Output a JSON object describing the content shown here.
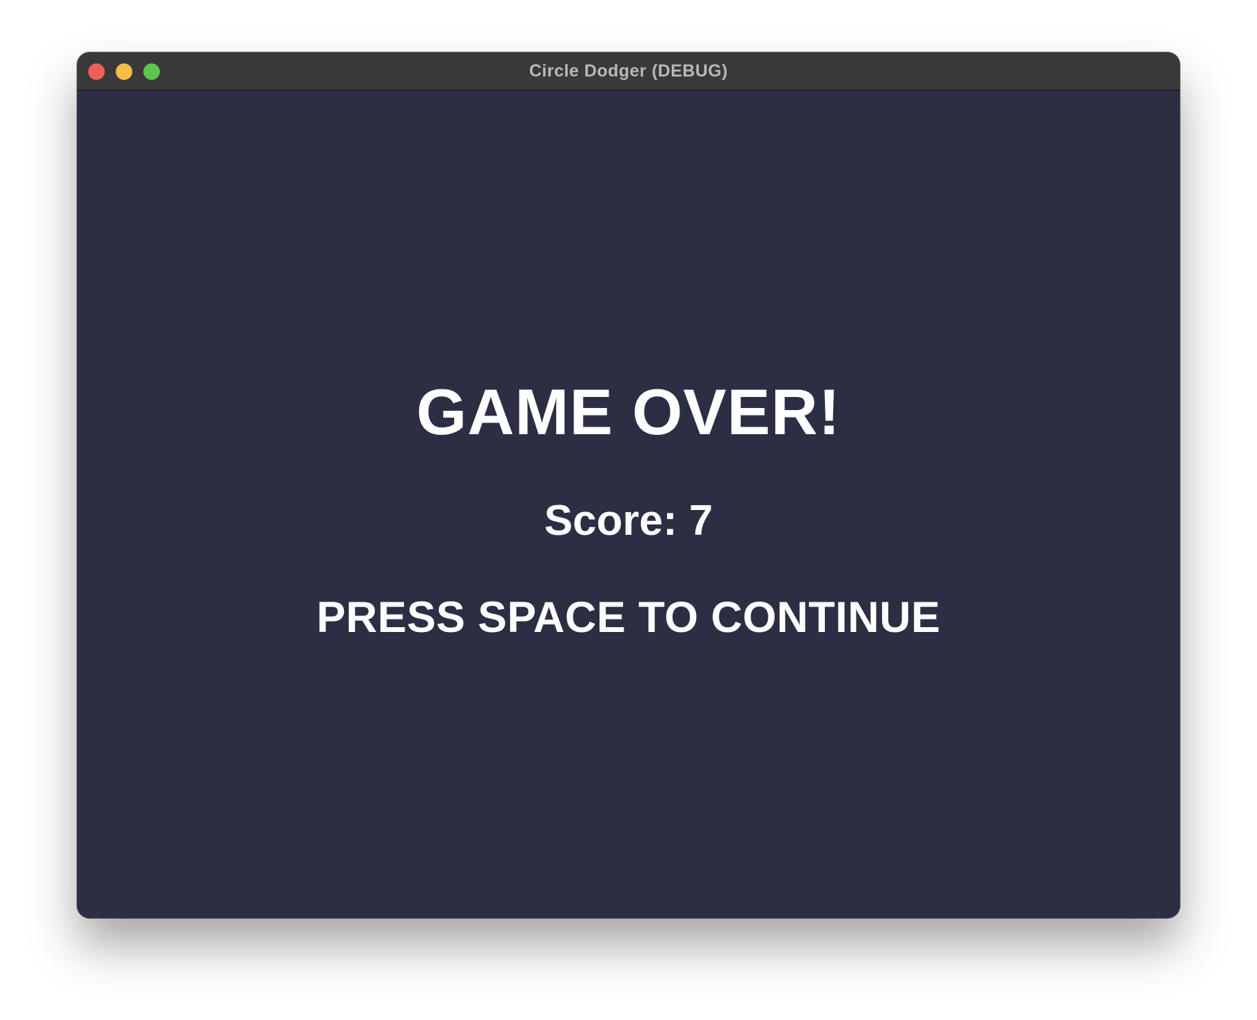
{
  "window": {
    "title": "Circle Dodger (DEBUG)"
  },
  "game": {
    "heading": "GAME OVER!",
    "score_text": "Score: 7",
    "prompt": "PRESS SPACE TO CONTINUE"
  },
  "colors": {
    "background": "#2c2e44",
    "titlebar": "#3a383b",
    "text": "#ffffff",
    "close": "#ee5f57",
    "minimize": "#f4bd43",
    "maximize": "#5cc84b"
  }
}
